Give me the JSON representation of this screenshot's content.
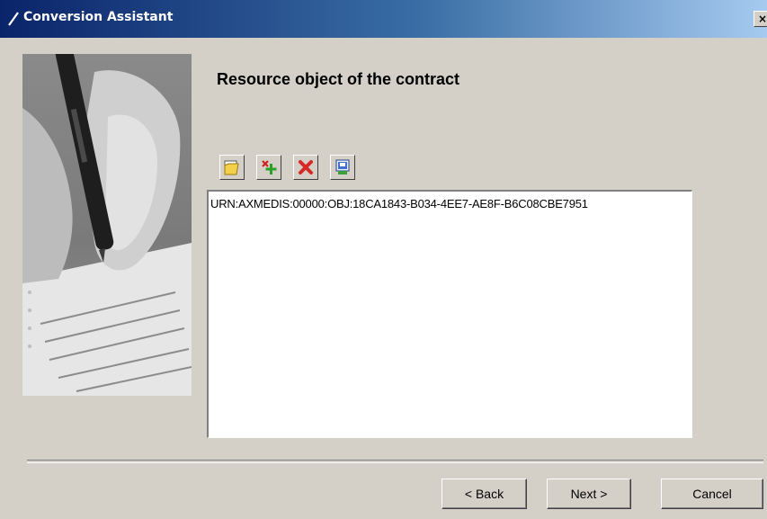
{
  "window": {
    "title": "Conversion Assistant",
    "close_glyph": "×"
  },
  "page": {
    "heading": "Resource object of the contract"
  },
  "toolbar": {
    "buttons": [
      {
        "name": "open-folder",
        "icon": "folder-open-icon"
      },
      {
        "name": "add-resource",
        "icon": "add-plus-icon"
      },
      {
        "name": "remove-resource",
        "icon": "delete-x-icon"
      },
      {
        "name": "properties",
        "icon": "properties-icon"
      }
    ]
  },
  "list": {
    "items": [
      "URN:AXMEDIS:00000:OBJ:18CA1843-B034-4EE7-AE8F-B6C08CBE7951"
    ]
  },
  "footer": {
    "back_label": "< Back",
    "next_label": "Next >",
    "cancel_label": "Cancel"
  },
  "colors": {
    "titlebar_start": "#0a246a",
    "titlebar_end": "#a6caf0",
    "dialog_bg": "#d4d0c8"
  }
}
